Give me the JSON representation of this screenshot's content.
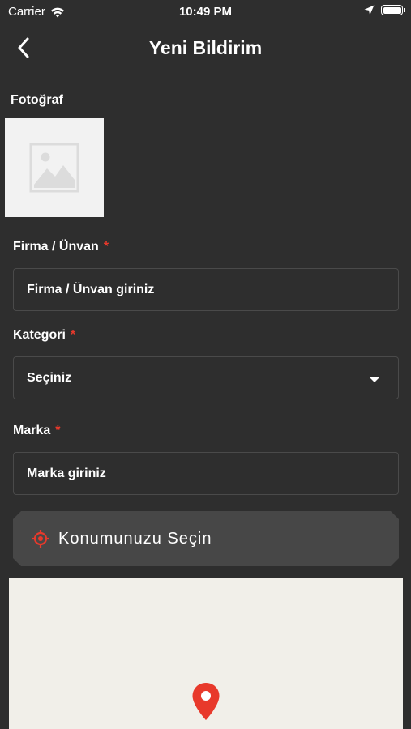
{
  "status_bar": {
    "carrier": "Carrier",
    "time": "10:49 PM"
  },
  "nav": {
    "title": "Yeni Bildirim",
    "back_icon": "chevron-left-icon"
  },
  "photo": {
    "label": "Fotoğraf",
    "placeholder_icon": "image-placeholder-icon"
  },
  "form": {
    "company": {
      "label": "Firma / Ünvan",
      "required": "*",
      "placeholder": "Firma / Ünvan giriniz"
    },
    "category": {
      "label": "Kategori",
      "required": "*",
      "selected": "Seçiniz"
    },
    "brand": {
      "label": "Marka",
      "required": "*",
      "placeholder": "Marka giriniz"
    }
  },
  "location": {
    "button_label": "Konumunuzu Seçin",
    "icon": "target-icon"
  },
  "map": {
    "pin_icon": "map-pin-icon"
  },
  "colors": {
    "background": "#2e2e2e",
    "accent": "#e8392b",
    "map_background": "#f1efe9"
  }
}
